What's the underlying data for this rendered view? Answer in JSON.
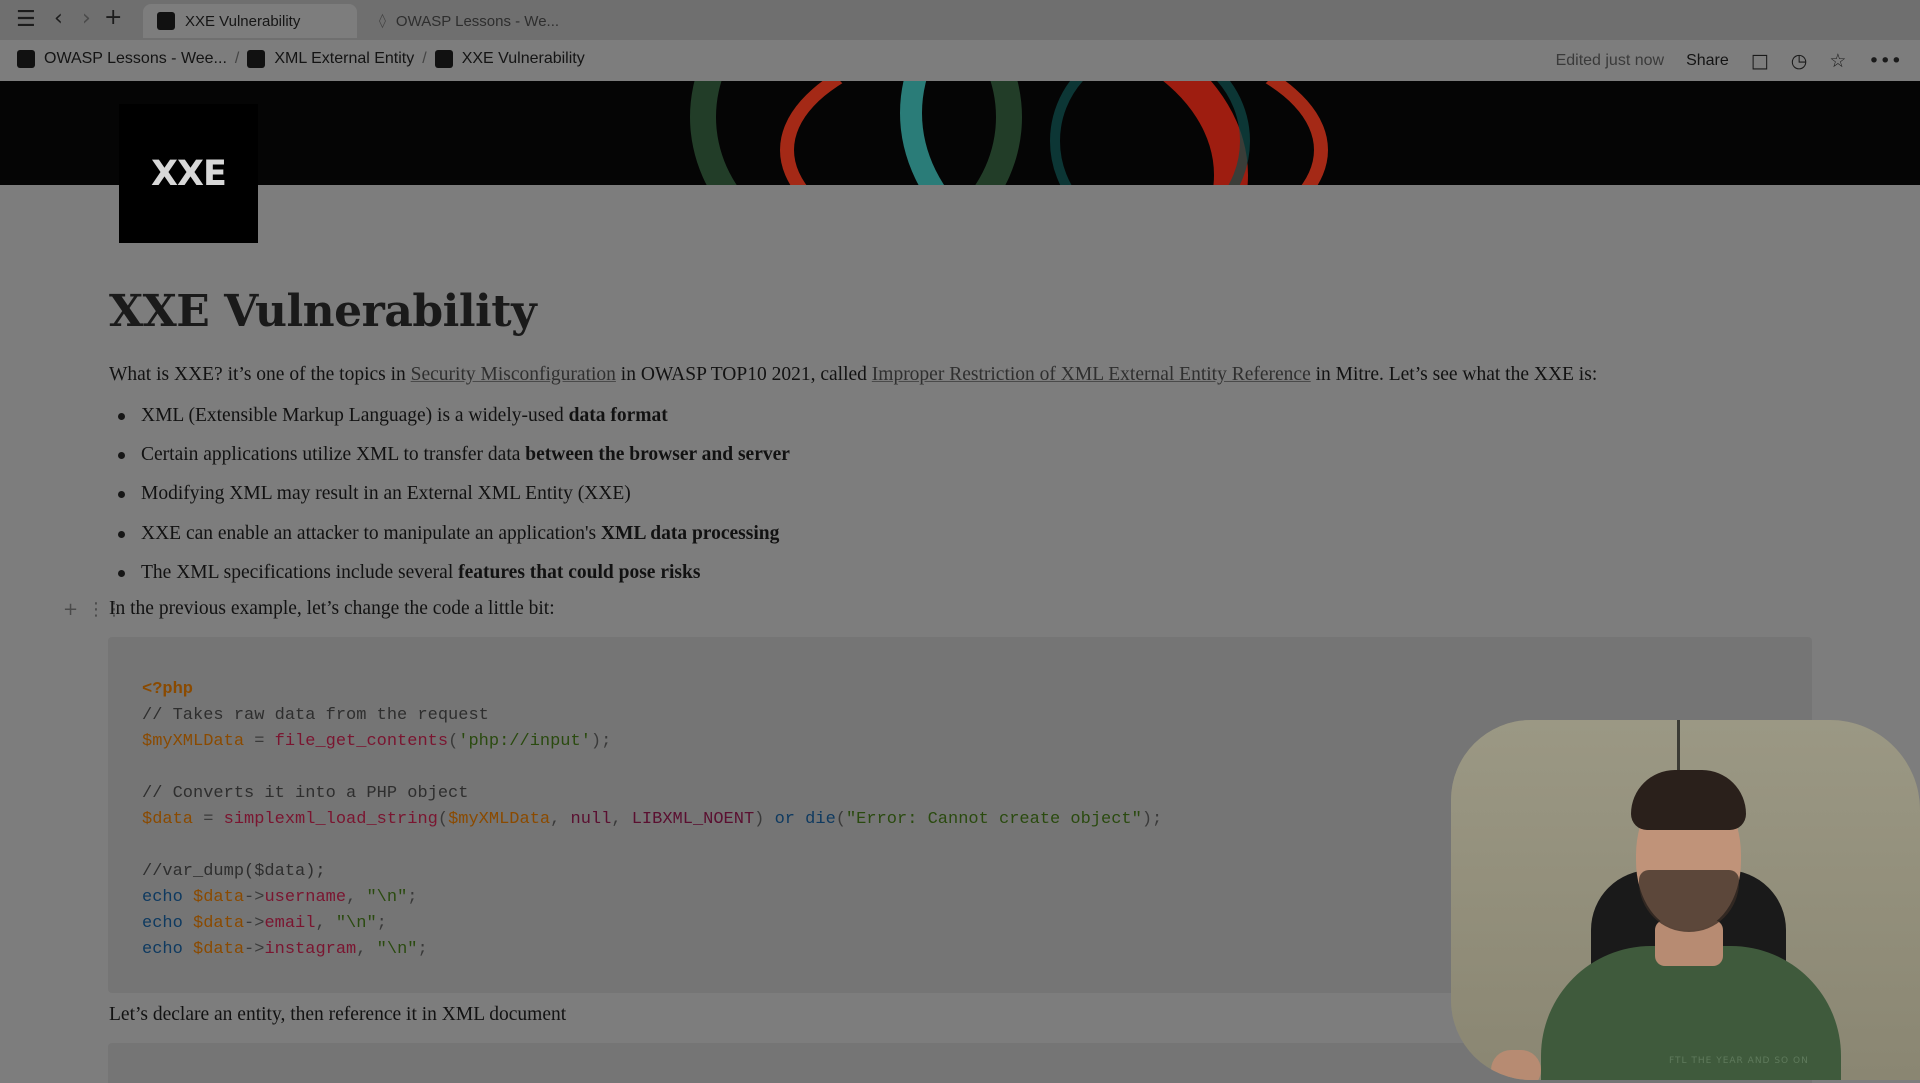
{
  "browser": {
    "tabs": [
      {
        "label": "XXE Vulnerability"
      },
      {
        "label": "OWASP Lessons - We..."
      }
    ]
  },
  "breadcrumb": [
    "OWASP Lessons - Wee...",
    "XML External Entity",
    "XXE Vulnerability"
  ],
  "topbar": {
    "edited": "Edited just now",
    "share": "Share"
  },
  "logo_text": "XXE",
  "page": {
    "title": "XXE Vulnerability",
    "intro": {
      "t1": "What is XXE? it’s one of the topics in ",
      "link1": "Security Misconfiguration",
      "t2": " in OWASP TOP10 2021, called ",
      "link2": "Improper Restriction of XML External Entity Reference",
      "t3": " in Mitre. Let’s see what the XXE is:"
    },
    "bullets": [
      {
        "plain": "XML (Extensible Markup Language) is a widely-used ",
        "bold": "data format"
      },
      {
        "plain": "Certain applications utilize XML to transfer data ",
        "bold": "between the browser and server"
      },
      {
        "plain": "Modifying XML may result in an External XML Entity (XXE)",
        "bold": ""
      },
      {
        "plain": "XXE can enable an attacker to manipulate an application's ",
        "bold": "XML data processing"
      },
      {
        "plain": "The XML specifications include several ",
        "bold": "features that could pose risks"
      }
    ],
    "para2": "In the previous example, let’s change the code a little bit:",
    "code": {
      "l1": "<?php",
      "l2": "// Takes raw data from the request",
      "l3a": "$myXMLData",
      "l3b": " = ",
      "l3c": "file_get_contents",
      "l3d": "(",
      "l3e": "'php://input'",
      "l3f": ");",
      "l4": "// Converts it into a PHP object",
      "l5a": "$data",
      "l5b": " = ",
      "l5c": "simplexml_load_string",
      "l5d": "(",
      "l5e": "$myXMLData",
      "l5f": ", ",
      "l5g": "null",
      "l5h": ", ",
      "l5i": "LIBXML_NOENT",
      "l5j": ") ",
      "l5k": "or",
      "l5l": " ",
      "l5m": "die",
      "l5n": "(",
      "l5o": "\"Error: Cannot create object\"",
      "l5p": ");",
      "l6": "//var_dump($data);",
      "echo": "echo",
      "dvar": "$data",
      "arrow": "->",
      "f1": "username",
      "f2": "email",
      "f3": "instagram",
      "comma": ", ",
      "nl": "\"\\n\"",
      "semi": ";"
    },
    "para3": "Let’s declare an entity, then reference it in XML document"
  },
  "webcam_shirt_text": "FTL THE YEAR AND SO ON"
}
